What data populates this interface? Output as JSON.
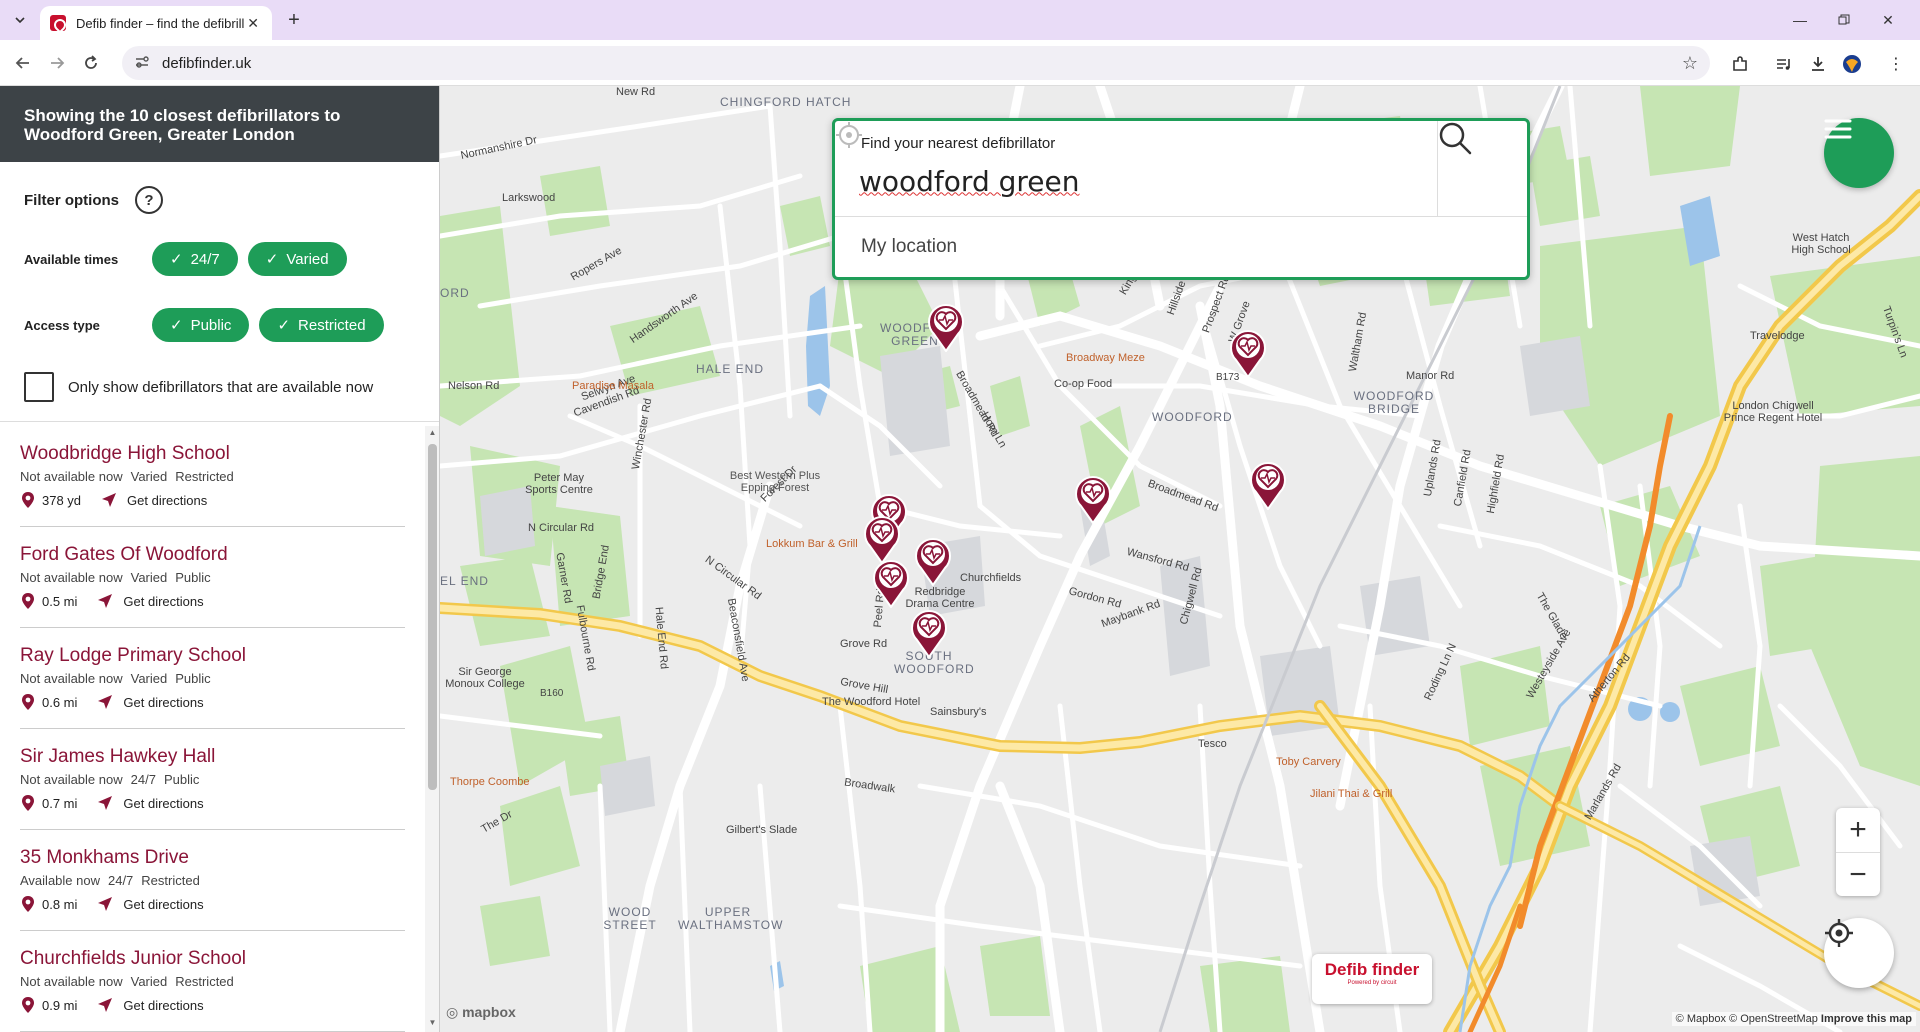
{
  "browser": {
    "tab_title": "Defib finder – find the defibrillator",
    "url": "defibfinder.uk"
  },
  "sidebar": {
    "header": "Showing the 10 closest defibrillators to Woodford Green, Greater London",
    "filter_title": "Filter options",
    "help": "?",
    "available_times_label": "Available times",
    "available_times": [
      "24/7",
      "Varied"
    ],
    "access_type_label": "Access type",
    "access_types": [
      "Public",
      "Restricted"
    ],
    "available_now_label": "Only show defibrillators that are available now",
    "directions_label": "Get directions",
    "results": [
      {
        "name": "Woodbridge High School",
        "status": "Not available now",
        "times": "Varied",
        "access": "Restricted",
        "distance": "378 yd"
      },
      {
        "name": "Ford Gates Of Woodford",
        "status": "Not available now",
        "times": "Varied",
        "access": "Public",
        "distance": "0.5 mi"
      },
      {
        "name": "Ray Lodge Primary School",
        "status": "Not available now",
        "times": "Varied",
        "access": "Public",
        "distance": "0.6 mi"
      },
      {
        "name": "Sir James Hawkey Hall",
        "status": "Not available now",
        "times": "24/7",
        "access": "Public",
        "distance": "0.7 mi"
      },
      {
        "name": "35 Monkhams Drive",
        "status": "Available now",
        "times": "24/7",
        "access": "Restricted",
        "distance": "0.8 mi"
      },
      {
        "name": "Churchfields Junior School",
        "status": "Not available now",
        "times": "Varied",
        "access": "Restricted",
        "distance": "0.9 mi"
      }
    ]
  },
  "search": {
    "heading": "Find your nearest defibrillator",
    "value": "woodford green",
    "my_location": "My location"
  },
  "map": {
    "places": [
      "CHINGFORD HATCH",
      "WOODFORD GREEN",
      "HALE END",
      "WOODFORD",
      "WOODFORD BRIDGE",
      "SOUTH WOODFORD",
      "WOOD STREET",
      "UPPER WALTHAMSTOW",
      "EL END",
      "ORD"
    ],
    "roads": [
      "New Rd",
      "Normanshire Dr",
      "Ropers Ave",
      "Handsworth Ave",
      "Nelson Rd",
      "Selwyn Ave",
      "Cavendish Rd",
      "Winchester Rd",
      "Forest Dr",
      "N Circular Rd",
      "N Circular Rd",
      "Garner Rd",
      "Bridge End",
      "Fulbourne Rd",
      "Hale End Rd",
      "Beaconsfield Ave",
      "Peel Rd",
      "Grove Rd",
      "Grove Hill",
      "Broadwalk",
      "King's Ave",
      "Hillside Ave",
      "Prospect Rd",
      "W Grove",
      "Broadmead Rd",
      "Horn Ln",
      "Broadmead Rd",
      "Wansford Rd",
      "Gordon Rd",
      "Maybank Rd",
      "Chigwell Rd",
      "Manor Rd",
      "B173",
      "B160",
      "Waltham Rd",
      "Uplands Rd",
      "Canfield Rd",
      "Highfield Rd",
      "The Glade",
      "Roding Ln N",
      "Westeyside Ave",
      "Atherton Rd",
      "Marlands Rd",
      "Turpin's Ln",
      "The Dr",
      "Larkswood"
    ],
    "pois": [
      "Paradise Masala",
      "Best Western Plus Epping Forest",
      "Lokkum Bar & Grill",
      "Broadway Meze",
      "Co-op Food",
      "Redbridge Drama Centre",
      "Churchfields",
      "The Woodford Hotel",
      "Sainsbury's",
      "Tesco",
      "Toby Carvery",
      "Jilani Thai & Grill",
      "Thorpe Coombe",
      "Gilbert's Slade",
      "Peter May Sports Centre",
      "Sir George Monoux College",
      "West Hatch High School",
      "Travelodge",
      "London Chigwell Prince Regent Hotel"
    ],
    "zoom_in": "+",
    "zoom_out": "−",
    "brand": "Defib finder",
    "brand_sub": "Powered by circuit",
    "mapbox": "mapbox",
    "attribution": [
      "© Mapbox",
      "© OpenStreetMap",
      "Improve this map"
    ]
  },
  "colors": {
    "accent_green": "#1e9d58",
    "marker": "#8a1538",
    "header_bg": "#3d4347",
    "tab_bar": "#e9dcf7"
  },
  "icons": {
    "search": "search-icon",
    "menu": "hamburger-icon",
    "locate": "crosshair-icon",
    "marker": "heart-pin-icon"
  }
}
